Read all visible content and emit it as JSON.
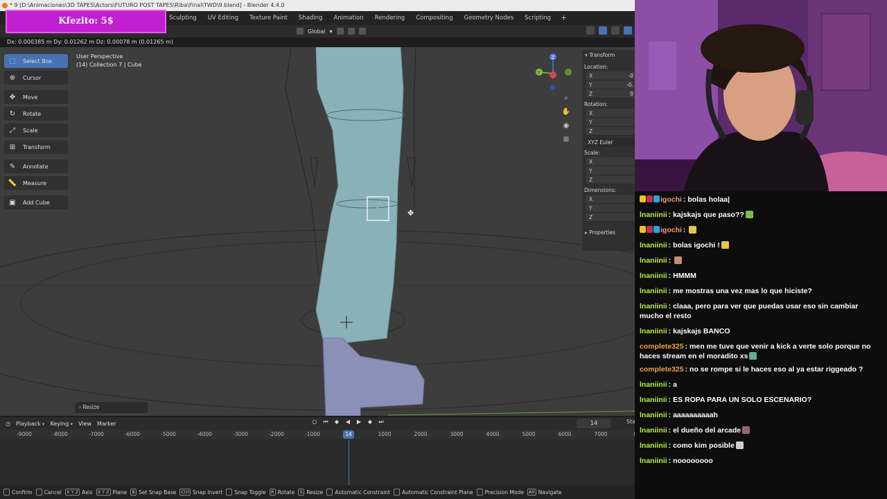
{
  "titlebar": {
    "text": "* 9 [D:\\Animaciones\\3D TAPES\\Actors\\FUTURO POST TAPES\\Riba\\Final\\TWD\\9.blend] - Blender 4.4.0"
  },
  "alert": {
    "text": "Kfezito: 5$"
  },
  "workspace_tabs": [
    "Sculpting",
    "UV Editing",
    "Texture Paint",
    "Shading",
    "Animation",
    "Rendering",
    "Compositing",
    "Geometry Nodes",
    "Scripting"
  ],
  "workspace_add": "+",
  "header": {
    "orientation": "Global"
  },
  "status_delta": "Dx: 0.000385 m   Dy: 0.01262 m   Dz: 0.00078 m (0.01265 m)",
  "viewport": {
    "perspective": "User Perspective",
    "collection": "(14) Collection 7 | Cube"
  },
  "tools": [
    {
      "label": "Select Box",
      "icon": "select-box-icon",
      "glyph": "⬚"
    },
    {
      "label": "Cursor",
      "icon": "cursor-icon",
      "glyph": "⊕"
    },
    {
      "label": "Move",
      "icon": "move-icon",
      "glyph": "✥"
    },
    {
      "label": "Rotate",
      "icon": "rotate-icon",
      "glyph": "↻"
    },
    {
      "label": "Scale",
      "icon": "scale-icon",
      "glyph": "⤢"
    },
    {
      "label": "Transform",
      "icon": "transform-icon",
      "glyph": "⊞"
    },
    {
      "label": "Annotate",
      "icon": "annotate-icon",
      "glyph": "✎"
    },
    {
      "label": "Measure",
      "icon": "measure-icon",
      "glyph": "📏"
    },
    {
      "label": "Add Cube",
      "icon": "add-cube-icon",
      "glyph": "▣"
    }
  ],
  "npanel": {
    "header": "Transform",
    "location": {
      "label": "Location:",
      "values": [
        "-0",
        "-0.",
        "0"
      ]
    },
    "rotation": {
      "label": "Rotation:"
    },
    "euler": "XYZ Euler",
    "scale": {
      "label": "Scale:"
    },
    "dimensions": {
      "label": "Dimensions:"
    },
    "axes": [
      "X",
      "Y",
      "Z"
    ],
    "properties": "Properties"
  },
  "resize_panel": "Resize",
  "timeline": {
    "menus": [
      "Playback",
      "Keying",
      "View",
      "Marker"
    ],
    "current_frame": "14",
    "start_label": "Sta",
    "ticks": [
      "-9000",
      "-8000",
      "-7000",
      "-6000",
      "-5000",
      "-4000",
      "-3000",
      "-2000",
      "-1000",
      "1000",
      "2000",
      "3000",
      "4000",
      "5000",
      "6000",
      "7000",
      "80"
    ],
    "playhead": "14"
  },
  "statusbar": [
    {
      "key": "",
      "label": "Confirm"
    },
    {
      "key": "",
      "label": "Cancel"
    },
    {
      "key": "X Y Z",
      "label": "Axis"
    },
    {
      "key": "X Y Z",
      "label": "Plane"
    },
    {
      "key": "B",
      "label": "Set Snap Base"
    },
    {
      "key": "Ctrl",
      "label": "Snap Invert"
    },
    {
      "key": "",
      "label": "Snap Toggle"
    },
    {
      "key": "R",
      "label": "Rotate"
    },
    {
      "key": "S",
      "label": "Resize"
    },
    {
      "key": "",
      "label": "Automatic Constraint"
    },
    {
      "key": "",
      "label": "Automatic Constraint Plane"
    },
    {
      "key": "",
      "label": "Precision Mode"
    },
    {
      "key": "Alt",
      "label": "Navigate"
    }
  ],
  "chat": [
    {
      "user": "igochi",
      "color": "#f39c6b",
      "text": "bolas holaa|",
      "badges": true,
      "emote": ""
    },
    {
      "user": "lnaniinii",
      "color": "#b8f03e",
      "text": "kajskajs que paso??",
      "emote": "#7ac142"
    },
    {
      "user": "igochi",
      "color": "#f39c6b",
      "text": "",
      "badges": true,
      "emote": "#e8c547"
    },
    {
      "user": "lnaniinii",
      "color": "#b8f03e",
      "text": "bolas igochi !",
      "emote": "#e8c547"
    },
    {
      "user": "lnaniinii",
      "color": "#b8f03e",
      "text": "",
      "emote": "#c98a7a"
    },
    {
      "user": "lnaniinii",
      "color": "#b8f03e",
      "text": "HMMM",
      "emote": ""
    },
    {
      "user": "lnaniinii",
      "color": "#b8f03e",
      "text": "me mostras una vez mas lo que hiciste?",
      "emote": ""
    },
    {
      "user": "lnaniinii",
      "color": "#b8f03e",
      "text": "claaa, pero para ver que puedas usar eso sin cambiar mucho el resto",
      "emote": ""
    },
    {
      "user": "lnaniinii",
      "color": "#b8f03e",
      "text": "kajskajs BANCO",
      "emote": ""
    },
    {
      "user": "complete325",
      "color": "#f0a040",
      "text": "men me tuve que venir a kick a verte solo porque no haces stream en el moradito xs",
      "emote": "#5ab0a0",
      "wrap": true
    },
    {
      "user": "complete325",
      "color": "#f0a040",
      "text": "no se rompe si le haces eso al ya estar riggeado ?",
      "emote": ""
    },
    {
      "user": "lnaniinii",
      "color": "#b8f03e",
      "text": "a",
      "emote": ""
    },
    {
      "user": "lnaniinii",
      "color": "#b8f03e",
      "text": "ES ROPA PARA UN SOLO ESCENARIO?",
      "emote": ""
    },
    {
      "user": "lnaniinii",
      "color": "#b8f03e",
      "text": "aaaaaaaaaah",
      "emote": ""
    },
    {
      "user": "lnaniinii",
      "color": "#b8f03e",
      "text": "el dueño del arcade",
      "emote": "#a0607a"
    },
    {
      "user": "lnaniinii",
      "color": "#b8f03e",
      "text": "como kim posible",
      "emote": "#cccccc"
    },
    {
      "user": "lnaniinii",
      "color": "#b8f03e",
      "text": "noooooooo",
      "emote": ""
    }
  ]
}
